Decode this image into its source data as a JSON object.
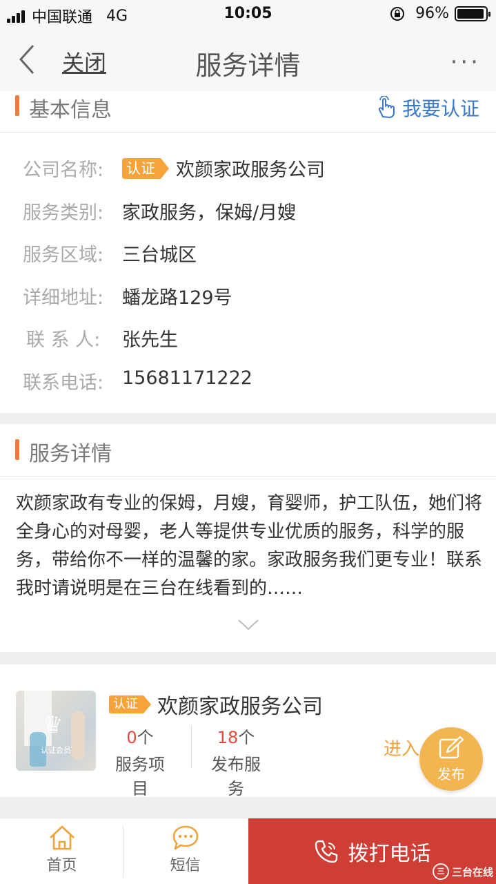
{
  "status_bar": {
    "carrier": "中国联通",
    "network": "4G",
    "time": "10:05",
    "battery": "96%",
    "battery_level": 0.96
  },
  "nav": {
    "close": "关闭",
    "title": "服务详情",
    "more": "···"
  },
  "basic_info": {
    "title": "基本信息",
    "verify_label": "我要认证",
    "badge": "认证",
    "rows": [
      {
        "label": "公司名称:",
        "value": "欢颜家政服务公司"
      },
      {
        "label": "服务类别:",
        "value": "家政服务，保姆/月嫂"
      },
      {
        "label": "服务区域:",
        "value": "三台城区"
      },
      {
        "label": "详细地址:",
        "value": "蟠龙路129号"
      },
      {
        "label": "联 系 人:",
        "value": "张先生"
      },
      {
        "label": "联系电话:",
        "value": "15681171222"
      }
    ]
  },
  "service_detail": {
    "title": "服务详情",
    "text": "欢颜家政有专业的保姆，月嫂，育婴师，护工队伍，她们将全身心的对母婴，老人等提供专业优质的服务，科学的服务，带给你不一样的温馨的家。家政服务我们更专业！联系我时请说明是在三台在线看到的……"
  },
  "company_card": {
    "badge": "认证",
    "name": "欢颜家政服务公司",
    "thumb_caption": "认证会员",
    "stats": [
      {
        "count": "0",
        "unit": "个",
        "label": "服务项目"
      },
      {
        "count": "18",
        "unit": "个",
        "label": "发布服务"
      }
    ],
    "enter": "进入"
  },
  "fab": {
    "label": "发布"
  },
  "tabbar": {
    "home": "首页",
    "sms": "短信",
    "call": "拨打电话"
  },
  "watermark": {
    "text": "三台在线"
  },
  "colors": {
    "accent": "#ef7b3b",
    "badge": "#f6a43a",
    "link": "#3a78c9",
    "call": "#cf3e35",
    "fab": "#f2b550"
  }
}
